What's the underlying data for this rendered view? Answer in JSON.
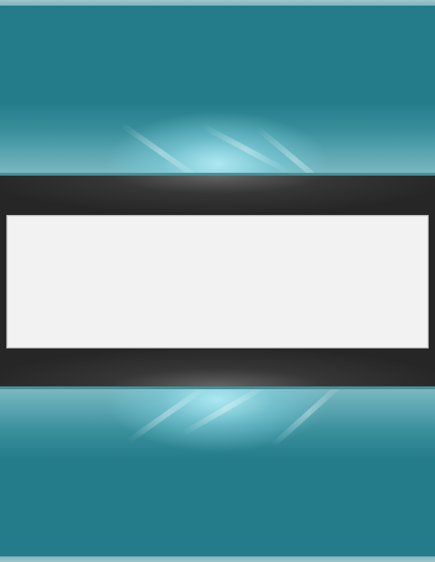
{
  "screen": {
    "type": "empty-dialog-over-wallpaper",
    "dialog": {
      "content_text": ""
    }
  },
  "colors": {
    "wallpaper": "#247b8a",
    "band": "#262626",
    "band_edge": "#4a8e97",
    "panel": "#f2f2f2"
  }
}
